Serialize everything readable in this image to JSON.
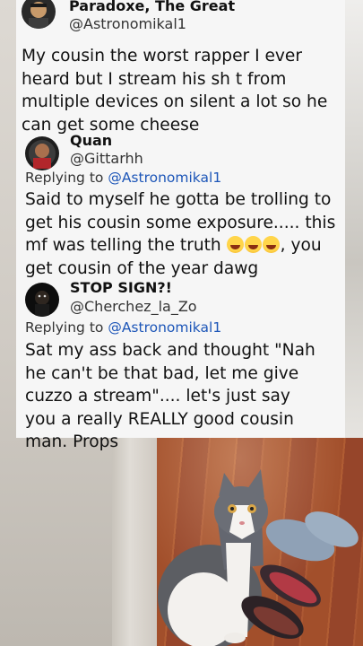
{
  "posts": [
    {
      "name": "Paradoxe, The Great",
      "handle": "@Astronomikal1",
      "body": "My cousin the worst rapper I ever heard but I stream his sh t from multiple devices on silent a lot so he can get some cheese"
    },
    {
      "name": "Quan",
      "handle": "@Gittarhh",
      "replying_prefix": "Replying to",
      "replying_to": "@Astronomikal1",
      "body_before_emoji": "Said to myself he gotta be trolling to get his cousin some exposure..... this mf was telling the truth ",
      "emoji_names": [
        "laughing-crying-emoji",
        "laughing-crying-emoji",
        "laughing-crying-emoji"
      ],
      "body_after_emoji": ", you get cousin of the year dawg"
    },
    {
      "name": "STOP SIGN?!",
      "handle": "@Cherchez_la_Zo",
      "replying_prefix": "Replying to",
      "replying_to": "@Astronomikal1",
      "body": "Sat my ass back and thought \"Nah he can't be that bad, let me give cuzzo a stream\".... let's just say you a really REALLY good cousin man. Props"
    }
  ],
  "colors": {
    "card_background": "#f6f6f6",
    "mention": "#1d56b8",
    "text": "#111111"
  }
}
